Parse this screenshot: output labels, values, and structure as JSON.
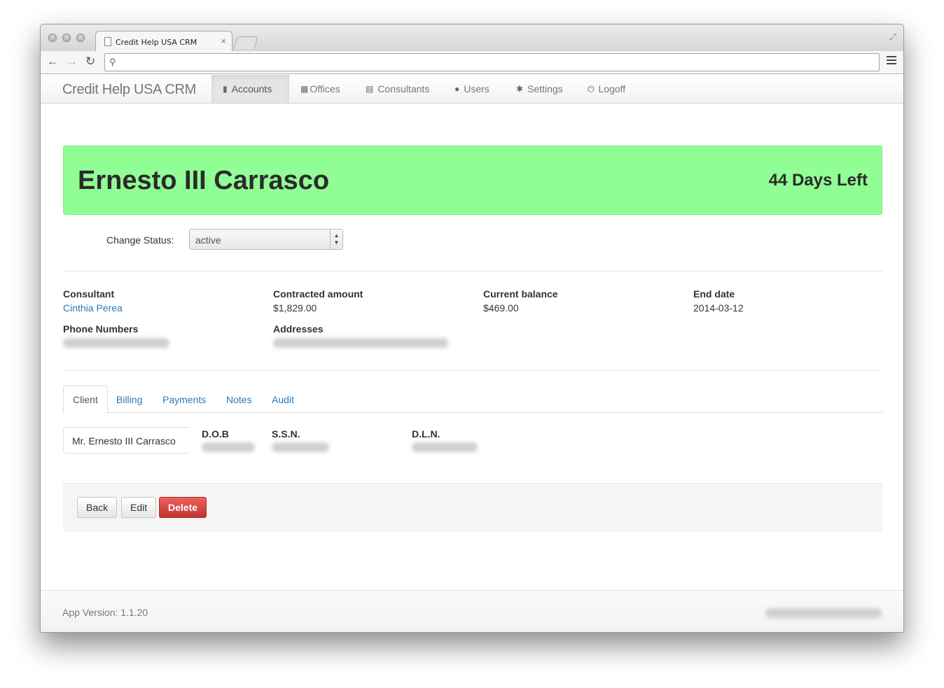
{
  "browser": {
    "tab_title": "Credit Help USA CRM",
    "tab_close": "×",
    "url": "",
    "back": "←",
    "forward": "→",
    "reload": "↻",
    "search_glyph": "⚲",
    "fullscreen_glyph": "⤢"
  },
  "navbar": {
    "brand": "Credit Help USA CRM",
    "items": [
      {
        "label": "Accounts",
        "icon": "bookmark-icon",
        "glyph": "▮"
      },
      {
        "label": "Offices",
        "icon": "grid-icon",
        "glyph": "▦"
      },
      {
        "label": "Consultants",
        "icon": "briefcase-icon",
        "glyph": "▤"
      },
      {
        "label": "Users",
        "icon": "user-icon",
        "glyph": "●"
      },
      {
        "label": "Settings",
        "icon": "gear-icon",
        "glyph": "✱"
      },
      {
        "label": "Logoff",
        "icon": "power-icon",
        "glyph": "⏻"
      }
    ],
    "active_item": "Accounts"
  },
  "account": {
    "name": "Ernesto III Carrasco",
    "days_left": "44 Days Left",
    "banner_color": "#90fd95"
  },
  "status": {
    "label": "Change Status:",
    "selected": "active",
    "arrows": "▲▼"
  },
  "details": {
    "consultant_label": "Consultant",
    "consultant_value": "Cinthia Perea",
    "contracted_label": "Contracted amount",
    "contracted_value": "$1,829.00",
    "balance_label": "Current balance",
    "balance_value": "$469.00",
    "end_date_label": "End date",
    "end_date_value": "2014-03-12",
    "phone_label": "Phone Numbers",
    "address_label": "Addresses"
  },
  "tabs": [
    "Client",
    "Billing",
    "Payments",
    "Notes",
    "Audit"
  ],
  "active_tab": "Client",
  "client": {
    "full_name": "Mr. Ernesto III Carrasco",
    "dob_label": "D.O.B",
    "ssn_label": "S.S.N.",
    "dln_label": "D.L.N."
  },
  "actions": {
    "back": "Back",
    "edit": "Edit",
    "delete": "Delete"
  },
  "footer": {
    "version": "App Version: 1.1.20"
  },
  "colors": {
    "link": "#2a7ab8",
    "danger": "#d9534f",
    "banner": "#90fd95"
  }
}
